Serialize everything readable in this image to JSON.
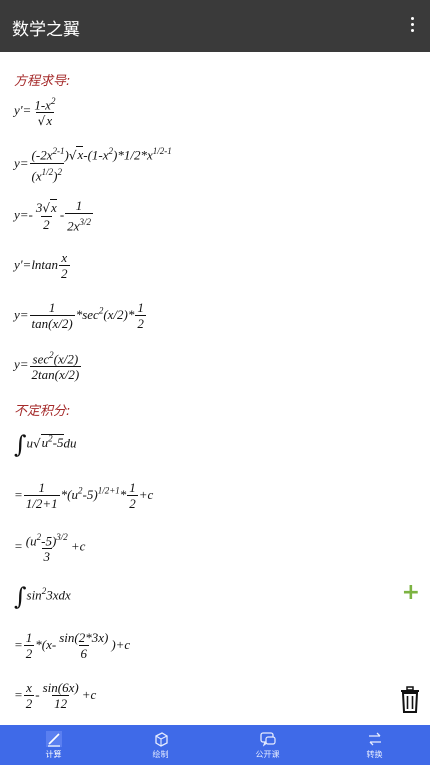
{
  "app": {
    "title": "数学之翼"
  },
  "sections": [
    {
      "heading": "方程求导:"
    },
    {
      "heading": "不定积分:"
    }
  ],
  "derivative": {
    "line1": {
      "lhs": "y'=",
      "num": "1-x",
      "num_sup": "2",
      "den_root": "x"
    },
    "line2": {
      "lhs": "y=",
      "num_a": "(-2x",
      "num_a_sup": "2-1",
      "num_b": ")",
      "num_root": "x",
      "num_c": "-(1-x",
      "num_c_sup": "2",
      "num_d": ")*1/2*x",
      "num_d_sup": "1/2-1",
      "den": "(x",
      "den_sup": "1/2",
      "den_b": ")",
      "den_sup2": "2"
    },
    "line3": {
      "lhs": "y=-",
      "num1": "3",
      "num1_root": "x",
      "den1": "2",
      "mid": "-",
      "num2": "1",
      "den2": "2x",
      "den2_sup": "3/2"
    },
    "line4": {
      "lhs": "y'=lntan",
      "num": "x",
      "den": "2"
    },
    "line5": {
      "lhs": "y=",
      "num1": "1",
      "den1": "tan(x/2)",
      "mid": "*sec",
      "mid_sup": "2",
      "mid2": "(x/2)*",
      "num2": "1",
      "den2": "2"
    },
    "line6": {
      "lhs": "y=",
      "num": "sec",
      "num_sup": "2",
      "num_b": "(x/2)",
      "den": "2tan(x/2)"
    }
  },
  "integral": {
    "line1": {
      "int": "∫",
      "a": "u",
      "root": "u",
      "root_sup": "2",
      "root_b": "-5",
      "b": "du"
    },
    "line2": {
      "lhs": "=",
      "num1": "1",
      "den1": "1/2+1",
      "mid": "*(u",
      "mid_sup": "2",
      "mid2": "-5)",
      "mid2_sup": "1/2+1",
      "mid3": "*",
      "num2": "1",
      "den2": "2",
      "tail": "+c"
    },
    "line3": {
      "lhs": "=",
      "num": "(u",
      "num_sup": "2",
      "num_b": "-5)",
      "num_sup2": "3/2",
      "den": "3",
      "tail": "+c"
    },
    "line4": {
      "int": "∫",
      "a": "sin",
      "a_sup": "2",
      "b": "3xdx"
    },
    "line5": {
      "lhs": "=",
      "num1": "1",
      "den1": "2",
      "mid": "*(x-",
      "num2": "sin(2*3x)",
      "den2": "6",
      "tail": ")+c"
    },
    "line6": {
      "lhs": "=",
      "num1": "x",
      "den1": "2",
      "mid": "-",
      "num2": "sin(6x)",
      "den2": "12",
      "tail": "+c"
    }
  },
  "actions": {
    "plus": "+"
  },
  "tabs": [
    {
      "label": "计算",
      "icon": "pencil-icon",
      "active": true
    },
    {
      "label": "绘制",
      "icon": "cube-icon",
      "active": false
    },
    {
      "label": "公开课",
      "icon": "chat-icon",
      "active": false
    },
    {
      "label": "转换",
      "icon": "swap-arrows-icon",
      "active": false
    }
  ],
  "colors": {
    "appbar": "#3a3a3a",
    "heading": "#a52a2a",
    "bottombar": "#3f6ae8",
    "plus": "#7cb342"
  }
}
